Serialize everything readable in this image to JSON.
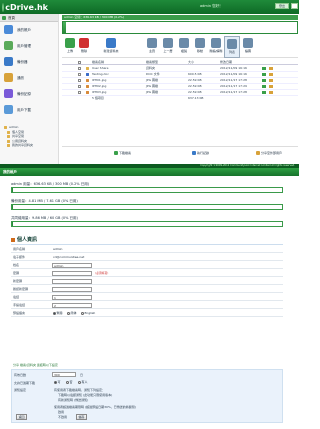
{
  "app": {
    "name": "cDrive.hk"
  },
  "header": {
    "user_line": "admin 您好！",
    "logout_label": "登出",
    "path_text": "admin 空間：636.63 KB / 300 MB (0.2%)"
  },
  "nav": {
    "title": "首頁",
    "items": [
      {
        "label": "我的帳戶",
        "color": "#4a8ad8"
      },
      {
        "label": "用戶管理",
        "color": "#5aaa5a"
      },
      {
        "label": "備份器",
        "color": "#3a7ac8"
      },
      {
        "label": "通訊",
        "color": "#d8a23a"
      },
      {
        "label": "備份記錄",
        "color": "#7a5ad8"
      },
      {
        "label": "用戶下載",
        "color": "#5a9ad8"
      }
    ],
    "tree": [
      "admin",
      "個人空間",
      "共享空間",
      "公用資料夾",
      "我的共享資料夾"
    ]
  },
  "toolbar": {
    "buttons": [
      {
        "label": "上傳",
        "color": "#3aa04a"
      },
      {
        "label": "刪除",
        "color": "#d03030"
      },
      {
        "label": "新建資料夾",
        "color": "#3a7ac8"
      },
      {
        "label": "主頁",
        "color": "#6a8aa8"
      },
      {
        "label": "上一層",
        "color": "#6a8aa8"
      },
      {
        "label": "複製",
        "color": "#6a8aa8"
      },
      {
        "label": "移動",
        "color": "#6a8aa8"
      },
      {
        "label": "壓縮/解壓",
        "color": "#6a8aa8"
      },
      {
        "label": "列表",
        "color": "#6a8aa8"
      },
      {
        "label": "縮圖",
        "color": "#6a8aa8"
      }
    ]
  },
  "files": {
    "headers": [
      "檔案名稱",
      "檔案類型",
      "大小",
      "修改日期"
    ],
    "rows": [
      {
        "name": "User Share",
        "type": "資料夾",
        "size": "",
        "date": "2012/11/09 16:16",
        "icon": "#e0b24a"
      },
      {
        "name": "Testing.doc",
        "type": "DOC 文件",
        "size": "600.5 KB",
        "date": "2012/11/09 16:16",
        "icon": "#3a6ac8"
      },
      {
        "name": "IPH01.jpg",
        "type": "JPG 圖檔",
        "size": "22.59 KB",
        "date": "2012/11/17 17:28",
        "icon": "#d88a3a"
      },
      {
        "name": "IPH02.jpg",
        "type": "JPG 圖檔",
        "size": "22.59 KB",
        "date": "2012/11/17 17:29",
        "icon": "#d88a3a"
      },
      {
        "name": "IPH03.jpg",
        "type": "JPG 圖檔",
        "size": "22.59 KB",
        "date": "2012/11/17 17:28",
        "icon": "#d88a3a"
      }
    ],
    "summary": "5 個項目",
    "total": "637.13 KB"
  },
  "bottom_links": [
    {
      "label": "下載檔案",
      "color": "#3aa04a"
    },
    {
      "label": "執行記錄",
      "color": "#3a7ac8"
    },
    {
      "label": "分享至外部用戶",
      "color": "#d8a23a"
    }
  ],
  "footer": "Copyright ©2009-2012 CommunityLink Internet Limited All rights reserved.",
  "account": {
    "title": "我的帳戶",
    "quotas": [
      {
        "label": "admin 用量：636.63 KB / 300 MB (0.2% 已用)",
        "fraction": 0.002
      },
      {
        "label": "備份用量：4.81 MB / 7.61 GB (0% 已用)",
        "fraction": 0.0
      },
      {
        "label": "共同總用量：9.86 MB / 60 GB (0% 已用)",
        "fraction": 0.0
      }
    ]
  },
  "personal": {
    "title": "個人資訊",
    "fields": [
      {
        "label": "用戶名稱",
        "value": "admin",
        "kind": "text"
      },
      {
        "label": "電子郵件",
        "value": "cd@communitee.net",
        "kind": "text"
      },
      {
        "label": "姓名",
        "value": "admin",
        "kind": "input"
      },
      {
        "label": "密碼",
        "value": "",
        "kind": "input",
        "hint": "(必須填寫)"
      },
      {
        "label": "新密碼",
        "value": "",
        "kind": "input"
      },
      {
        "label": "確認新密碼",
        "value": "",
        "kind": "input"
      },
      {
        "label": "電話",
        "value": "1",
        "kind": "input"
      },
      {
        "label": "手提電話",
        "value": "2",
        "kind": "input"
      },
      {
        "label": "預設語言",
        "value": "",
        "kind": "radio"
      }
    ],
    "languages": [
      "繁體",
      "简体",
      "English"
    ],
    "share_info": "分享 檔案/資料夾 連結時以下設定",
    "settings": [
      {
        "label": "有效日數",
        "value": "300",
        "unit": "日"
      },
      {
        "label": "允許已過期下載",
        "options": [
          "可",
          "否",
          "有人"
        ]
      },
      {
        "label": "通知設定",
        "lines": [
          "有使用者下載檔案時，通知下列設定：",
          "下載時以電郵通知 (此功能只限使用版本)",
          "有新通知時 (傳送通知)"
        ]
      },
      {
        "label": "",
        "lines": [
          "使用者超過檔案期限時 (超過預設日期30%，已傳送的將關閉)",
          "啟用",
          "不啟用"
        ]
      }
    ],
    "back_label": "返回",
    "save_label": "儲存"
  }
}
